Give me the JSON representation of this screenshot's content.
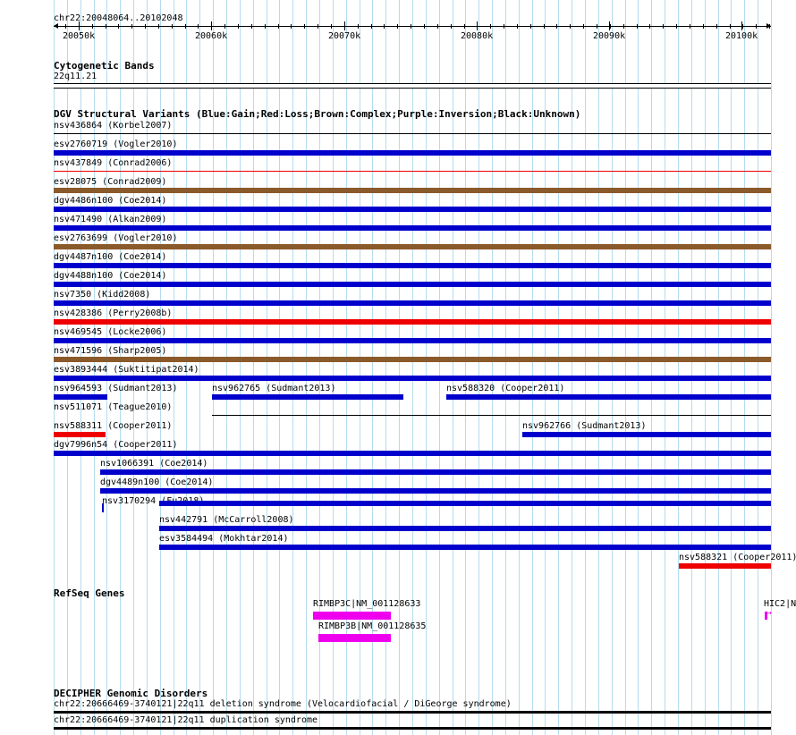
{
  "ruler": {
    "position": "chr22:20048064..20102048",
    "ticks": [
      "20050k",
      "20060k",
      "20070k",
      "20080k",
      "20090k",
      "20100k"
    ]
  },
  "cytoband": {
    "title": "Cytogenetic Bands",
    "band": "22q11.21"
  },
  "dgv": {
    "title": "DGV Structural Variants (Blue:Gain;Red:Loss;Brown:Complex;Purple:Inversion;Black:Unknown)",
    "colors": {
      "gain": "#0000cc",
      "loss": "#ee0000",
      "complex": "#8b5a2b",
      "unknown": "#000000"
    },
    "rows": [
      [
        {
          "label": "nsv436864 (Korbel2007)",
          "type": "unknown"
        }
      ],
      [
        {
          "label": "esv2760719 (Vogler2010)",
          "type": "gain"
        }
      ],
      [
        {
          "label": "nsv437849 (Conrad2006)",
          "type": "loss"
        }
      ],
      [
        {
          "label": "esv28075 (Conrad2009)",
          "type": "complex"
        }
      ],
      [
        {
          "label": "dgv4486n100 (Coe2014)",
          "type": "gain"
        }
      ],
      [
        {
          "label": "nsv471490 (Alkan2009)",
          "type": "gain"
        }
      ],
      [
        {
          "label": "esv2763699 (Vogler2010)",
          "type": "complex"
        }
      ],
      [
        {
          "label": "dgv4487n100 (Coe2014)",
          "type": "gain"
        }
      ],
      [
        {
          "label": "dgv4488n100 (Coe2014)",
          "type": "gain"
        }
      ],
      [
        {
          "label": "nsv7350 (Kidd2008)",
          "type": "gain"
        }
      ],
      [
        {
          "label": "nsv428386 (Perry2008b)",
          "type": "loss"
        }
      ],
      [
        {
          "label": "nsv469545 (Locke2006)",
          "type": "gain"
        }
      ],
      [
        {
          "label": "nsv471596 (Sharp2005)",
          "type": "complex"
        }
      ],
      [
        {
          "label": "esv3893444 (Suktitipat2014)",
          "type": "gain"
        }
      ],
      [
        {
          "label": "nsv964593 (Sudmant2013)",
          "type": "gain"
        },
        {
          "label": "nsv962765 (Sudmant2013)",
          "type": "gain"
        },
        {
          "label": "nsv588320 (Cooper2011)",
          "type": "gain"
        }
      ],
      [
        {
          "label": "nsv511071 (Teague2010)",
          "type": "unknown"
        }
      ],
      [
        {
          "label": "nsv588311 (Cooper2011)",
          "type": "loss"
        },
        {
          "label": "nsv962766 (Sudmant2013)",
          "type": "gain"
        }
      ],
      [
        {
          "label": "dgv7996n54 (Cooper2011)",
          "type": "gain"
        }
      ],
      [
        {
          "label": "nsv1066391 (Coe2014)",
          "type": "gain"
        }
      ],
      [
        {
          "label": "dgv4489n100 (Coe2014)",
          "type": "gain"
        }
      ],
      [
        {
          "label": "nsv3170294 (Fu2018)",
          "type": "gain"
        }
      ],
      [
        {
          "label": "nsv442791 (McCarroll2008)",
          "type": "gain"
        }
      ],
      [
        {
          "label": "esv3584494 (Mokhtar2014)",
          "type": "gain"
        }
      ],
      [
        {
          "label": "nsv588321 (Cooper2011)",
          "type": "loss"
        }
      ]
    ]
  },
  "refseq": {
    "title": "RefSeq Genes",
    "color": "#ee00ee",
    "genes": [
      {
        "label": "RIMBP3C|NM_001128633"
      },
      {
        "label": "RIMBP3B|NM_001128635"
      },
      {
        "label": "HIC2|N"
      }
    ]
  },
  "decipher": {
    "title": "DECIPHER Genomic Disorders",
    "rows": [
      {
        "label": "chr22:20666469-3740121|22q11 deletion syndrome (Velocardiofacial / DiGeorge syndrome)"
      },
      {
        "label": "chr22:20666469-3740121|22q11 duplication syndrome"
      }
    ]
  }
}
